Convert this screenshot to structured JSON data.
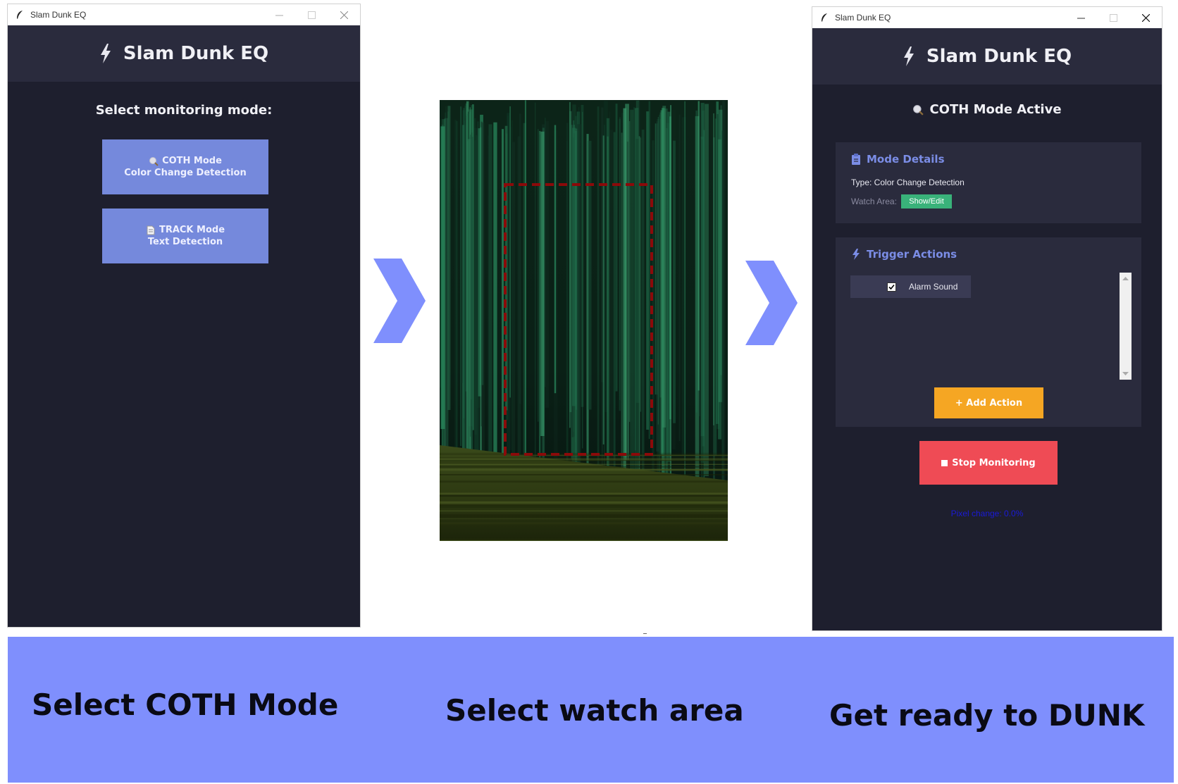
{
  "app": {
    "title": "Slam Dunk EQ",
    "window_title": "Slam Dunk EQ"
  },
  "select_screen": {
    "prompt": "Select monitoring mode:",
    "coth_button": {
      "line1": "COTH Mode",
      "line2": "Color Change Detection"
    },
    "track_button": {
      "line1": "TRACK Mode",
      "line2": "Text Detection"
    }
  },
  "active_screen": {
    "status": "COTH Mode Active",
    "mode_details": {
      "title": "Mode Details",
      "type_text": "Type: Color Change Detection",
      "watch_area_label": "Watch Area:",
      "show_edit_label": "Show/Edit"
    },
    "trigger_actions": {
      "title": "Trigger Actions",
      "items": [
        {
          "label": "Alarm Sound",
          "checked": true
        }
      ],
      "add_action_label": "+ Add Action"
    },
    "stop_label": "Stop Monitoring",
    "pixel_change": "Pixel change: 0.0%"
  },
  "steps": [
    "Select COTH Mode",
    "Select watch area",
    "Get ready to DUNK"
  ],
  "colors": {
    "window_bg": "#1e1f2e",
    "header_bg": "#2a2b3d",
    "mode_button": "#7589dc",
    "accent_text": "#7b8de6",
    "badge_green": "#39b27a",
    "add_action_orange": "#f5a623",
    "stop_red": "#ef4b55",
    "banner": "#7f8ffd",
    "watch_area_outline": "#8b0a0a"
  },
  "icons": [
    "feather-icon",
    "minimize-icon",
    "maximize-icon",
    "close-icon",
    "bolt-icon",
    "magnifier-icon",
    "document-icon",
    "clipboard-icon",
    "checkbox-icon",
    "chevron-right-icon",
    "stop-square-icon"
  ]
}
